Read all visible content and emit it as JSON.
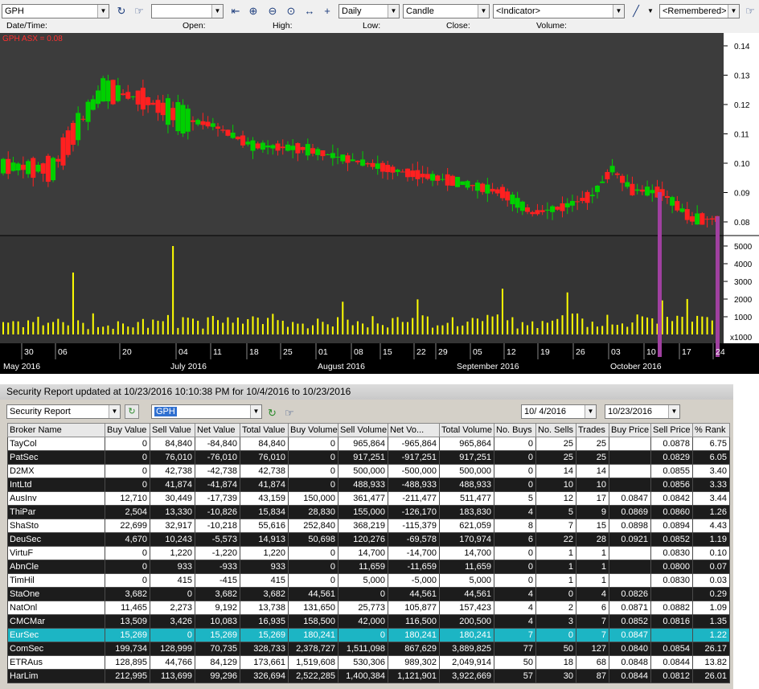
{
  "toolbar": {
    "symbol": "GPH",
    "symbol2": "",
    "period": "Daily",
    "chart_type": "Candle",
    "indicator": "<Indicator>",
    "remembered": "<Remembered>",
    "icons": [
      "refresh-icon",
      "insert-icon",
      "go-start-icon",
      "zoom-in-icon",
      "zoom-out-icon",
      "zoom-fit-icon",
      "stretch-icon",
      "crosshair-icon",
      "line-draw-icon"
    ]
  },
  "infobar": {
    "date": "Date/Time:",
    "open": "Open:",
    "high": "High:",
    "low": "Low:",
    "close": "Close:",
    "volume": "Volume:"
  },
  "chart_data": {
    "type": "candlestick",
    "legend": "GPH ASX = 0.08",
    "price_ticks": [
      "0.14",
      "0.13",
      "0.12",
      "0.11",
      "0.10",
      "0.09",
      "0.08"
    ],
    "volume_ticks": [
      "5000",
      "4000",
      "3000",
      "2000",
      "1000",
      "x1000"
    ],
    "day_ticks": [
      "30",
      "06",
      "20",
      "04",
      "11",
      "18",
      "25",
      "01",
      "08",
      "15",
      "22",
      "29",
      "05",
      "12",
      "19",
      "26",
      "03",
      "10",
      "17",
      "24"
    ],
    "month_ticks": [
      "May  2016",
      "July  2016",
      "August  2016",
      "September  2016",
      "October  2016"
    ],
    "price_ylim": [
      0.075,
      0.145
    ],
    "volume_ylim": [
      0,
      5600
    ],
    "colors": {
      "up": "#00d000",
      "down": "#ff2020",
      "bg": "#3c3c3c",
      "volume": "#ffff00",
      "marker": "#a040a0"
    }
  },
  "report": {
    "title": "Security Report updated at 10/23/2016 10:10:38 PM for 10/4/2016 to 10/23/2016",
    "report_type": "Security Report",
    "symbol": "GPH",
    "date_from": "10/  4/2016",
    "date_to": "10/23/2016",
    "columns": [
      "Broker Name",
      "Buy Value",
      "Sell Value",
      "Net Value",
      "Total Value",
      "Buy Volume",
      "Sell Volume",
      "Net Vo...",
      "Total Volume",
      "No. Buys",
      "No. Sells",
      "Trades",
      "Buy Price",
      "Sell Price",
      "% Rank"
    ],
    "rows": [
      [
        "TayCol",
        "0",
        "84,840",
        "-84,840",
        "84,840",
        "0",
        "965,864",
        "-965,864",
        "965,864",
        "0",
        "25",
        "25",
        "",
        "0.0878",
        "6.75"
      ],
      [
        "PatSec",
        "0",
        "76,010",
        "-76,010",
        "76,010",
        "0",
        "917,251",
        "-917,251",
        "917,251",
        "0",
        "25",
        "25",
        "",
        "0.0829",
        "6.05"
      ],
      [
        "D2MX",
        "0",
        "42,738",
        "-42,738",
        "42,738",
        "0",
        "500,000",
        "-500,000",
        "500,000",
        "0",
        "14",
        "14",
        "",
        "0.0855",
        "3.40"
      ],
      [
        "IntLtd",
        "0",
        "41,874",
        "-41,874",
        "41,874",
        "0",
        "488,933",
        "-488,933",
        "488,933",
        "0",
        "10",
        "10",
        "",
        "0.0856",
        "3.33"
      ],
      [
        "AusInv",
        "12,710",
        "30,449",
        "-17,739",
        "43,159",
        "150,000",
        "361,477",
        "-211,477",
        "511,477",
        "5",
        "12",
        "17",
        "0.0847",
        "0.0842",
        "3.44"
      ],
      [
        "ThiPar",
        "2,504",
        "13,330",
        "-10,826",
        "15,834",
        "28,830",
        "155,000",
        "-126,170",
        "183,830",
        "4",
        "5",
        "9",
        "0.0869",
        "0.0860",
        "1.26"
      ],
      [
        "ShaSto",
        "22,699",
        "32,917",
        "-10,218",
        "55,616",
        "252,840",
        "368,219",
        "-115,379",
        "621,059",
        "8",
        "7",
        "15",
        "0.0898",
        "0.0894",
        "4.43"
      ],
      [
        "DeuSec",
        "4,670",
        "10,243",
        "-5,573",
        "14,913",
        "50,698",
        "120,276",
        "-69,578",
        "170,974",
        "6",
        "22",
        "28",
        "0.0921",
        "0.0852",
        "1.19"
      ],
      [
        "VirtuF",
        "0",
        "1,220",
        "-1,220",
        "1,220",
        "0",
        "14,700",
        "-14,700",
        "14,700",
        "0",
        "1",
        "1",
        "",
        "0.0830",
        "0.10"
      ],
      [
        "AbnCle",
        "0",
        "933",
        "-933",
        "933",
        "0",
        "11,659",
        "-11,659",
        "11,659",
        "0",
        "1",
        "1",
        "",
        "0.0800",
        "0.07"
      ],
      [
        "TimHil",
        "0",
        "415",
        "-415",
        "415",
        "0",
        "5,000",
        "-5,000",
        "5,000",
        "0",
        "1",
        "1",
        "",
        "0.0830",
        "0.03"
      ],
      [
        "StaOne",
        "3,682",
        "0",
        "3,682",
        "3,682",
        "44,561",
        "0",
        "44,561",
        "44,561",
        "4",
        "0",
        "4",
        "0.0826",
        "",
        "0.29"
      ],
      [
        "NatOnl",
        "11,465",
        "2,273",
        "9,192",
        "13,738",
        "131,650",
        "25,773",
        "105,877",
        "157,423",
        "4",
        "2",
        "6",
        "0.0871",
        "0.0882",
        "1.09"
      ],
      [
        "CMCMar",
        "13,509",
        "3,426",
        "10,083",
        "16,935",
        "158,500",
        "42,000",
        "116,500",
        "200,500",
        "4",
        "3",
        "7",
        "0.0852",
        "0.0816",
        "1.35"
      ],
      [
        "EurSec",
        "15,269",
        "0",
        "15,269",
        "15,269",
        "180,241",
        "0",
        "180,241",
        "180,241",
        "7",
        "0",
        "7",
        "0.0847",
        "",
        "1.22"
      ],
      [
        "ComSec",
        "199,734",
        "128,999",
        "70,735",
        "328,733",
        "2,378,727",
        "1,511,098",
        "867,629",
        "3,889,825",
        "77",
        "50",
        "127",
        "0.0840",
        "0.0854",
        "26.17"
      ],
      [
        "ETRAus",
        "128,895",
        "44,766",
        "84,129",
        "173,661",
        "1,519,608",
        "530,306",
        "989,302",
        "2,049,914",
        "50",
        "18",
        "68",
        "0.0848",
        "0.0844",
        "13.82"
      ],
      [
        "HarLim",
        "212,995",
        "113,699",
        "99,296",
        "326,694",
        "2,522,285",
        "1,400,384",
        "1,121,901",
        "3,922,669",
        "57",
        "30",
        "87",
        "0.0844",
        "0.0812",
        "26.01"
      ]
    ]
  }
}
